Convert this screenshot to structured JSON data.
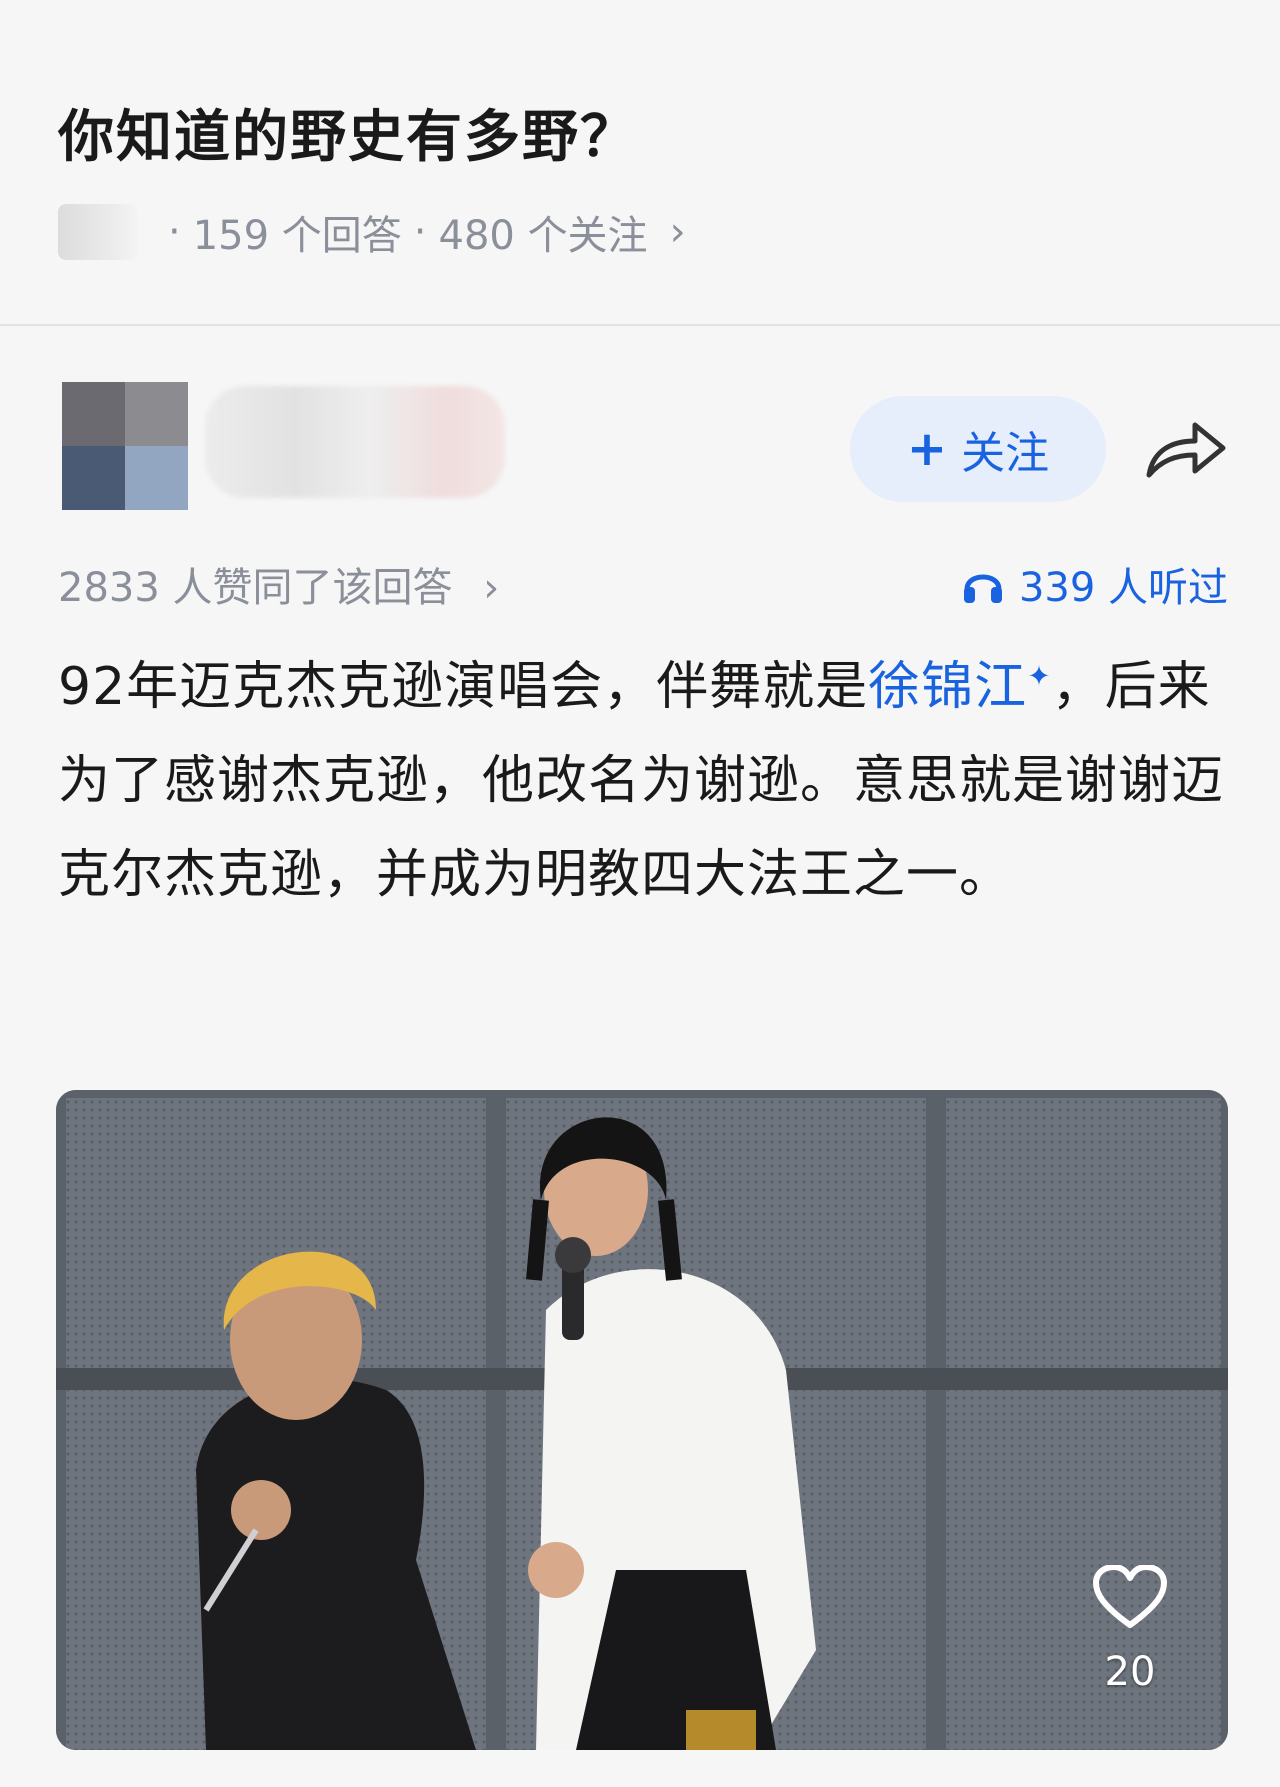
{
  "question": {
    "title": "你知道的野史有多野？",
    "answer_count": "159 个回答",
    "follow_count": "480 个关注",
    "separator": "·",
    "chevron": "›"
  },
  "author": {
    "follow_label": "关注",
    "follow_prefix": "+",
    "share_icon": "share-arrow-icon"
  },
  "stats": {
    "likes_text": "2833 人赞同了该回答",
    "chevron": "›",
    "listened_text": "339 人听过",
    "listen_icon": "headphone-icon"
  },
  "answer": {
    "text_before_link": "92年迈克杰克逊演唱会，伴舞就是",
    "link_text": "徐锦江",
    "link_marker": "✦",
    "text_after_link": "，后来为了感谢杰克逊，他改名为谢逊。意思就是谢谢迈克尔杰克逊，并成为明教四大法王之一。"
  },
  "image": {
    "like_count": "20",
    "like_icon": "heart-outline-icon"
  },
  "colors": {
    "accent": "#1a63e0",
    "muted": "#8a8f99",
    "background": "#f6f6f6"
  }
}
